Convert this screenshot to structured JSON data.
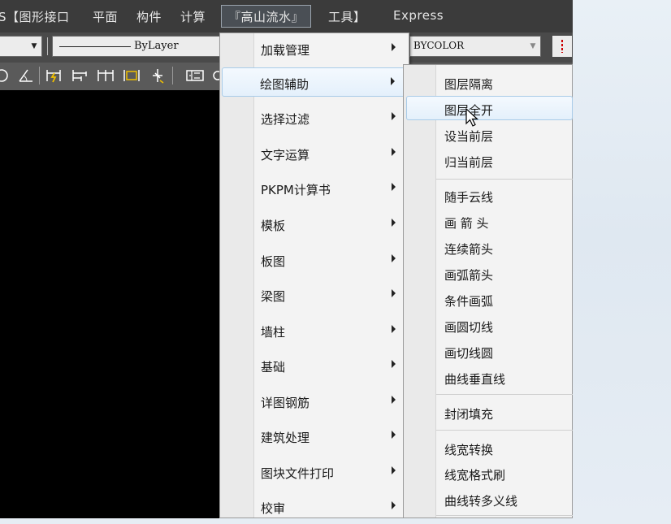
{
  "menubar": {
    "items": [
      {
        "label": "S【图形接口"
      },
      {
        "label": "平面"
      },
      {
        "label": "构件"
      },
      {
        "label": "计算"
      },
      {
        "label": "『高山流水』"
      },
      {
        "label": "工具】"
      },
      {
        "label": "Express"
      }
    ]
  },
  "toolbar": {
    "linetype_value": "ByLayer",
    "color_value": "BYCOLOR"
  },
  "menu": {
    "items": [
      {
        "label": "加载管理"
      },
      {
        "label": "绘图辅助"
      },
      {
        "label": "选择过滤"
      },
      {
        "label": "文字运算"
      },
      {
        "label": "PKPM计算书"
      },
      {
        "label": "模板"
      },
      {
        "label": "板图"
      },
      {
        "label": "梁图"
      },
      {
        "label": "墙柱"
      },
      {
        "label": "基础"
      },
      {
        "label": "详图钢筋"
      },
      {
        "label": "建筑处理"
      },
      {
        "label": "图块文件打印"
      },
      {
        "label": "校审"
      }
    ]
  },
  "submenu": {
    "items": [
      {
        "label": "图层隔离"
      },
      {
        "label": "图层全开"
      },
      {
        "label": "设当前层"
      },
      {
        "label": "归当前层"
      },
      {
        "label": "随手云线"
      },
      {
        "label": "画 箭 头"
      },
      {
        "label": "连续箭头"
      },
      {
        "label": "画弧箭头"
      },
      {
        "label": "条件画弧"
      },
      {
        "label": "画圆切线"
      },
      {
        "label": "画切线圆"
      },
      {
        "label": "曲线垂直线"
      },
      {
        "label": "封闭填充"
      },
      {
        "label": "线宽转换"
      },
      {
        "label": "线宽格式刷"
      },
      {
        "label": "曲线转多义线"
      }
    ]
  },
  "colors": {
    "menubar_bg": "#3b3b3b",
    "menu_bg": "#f3f3f3",
    "highlight_border": "#a8cbe8",
    "canvas_bg": "#000000"
  }
}
